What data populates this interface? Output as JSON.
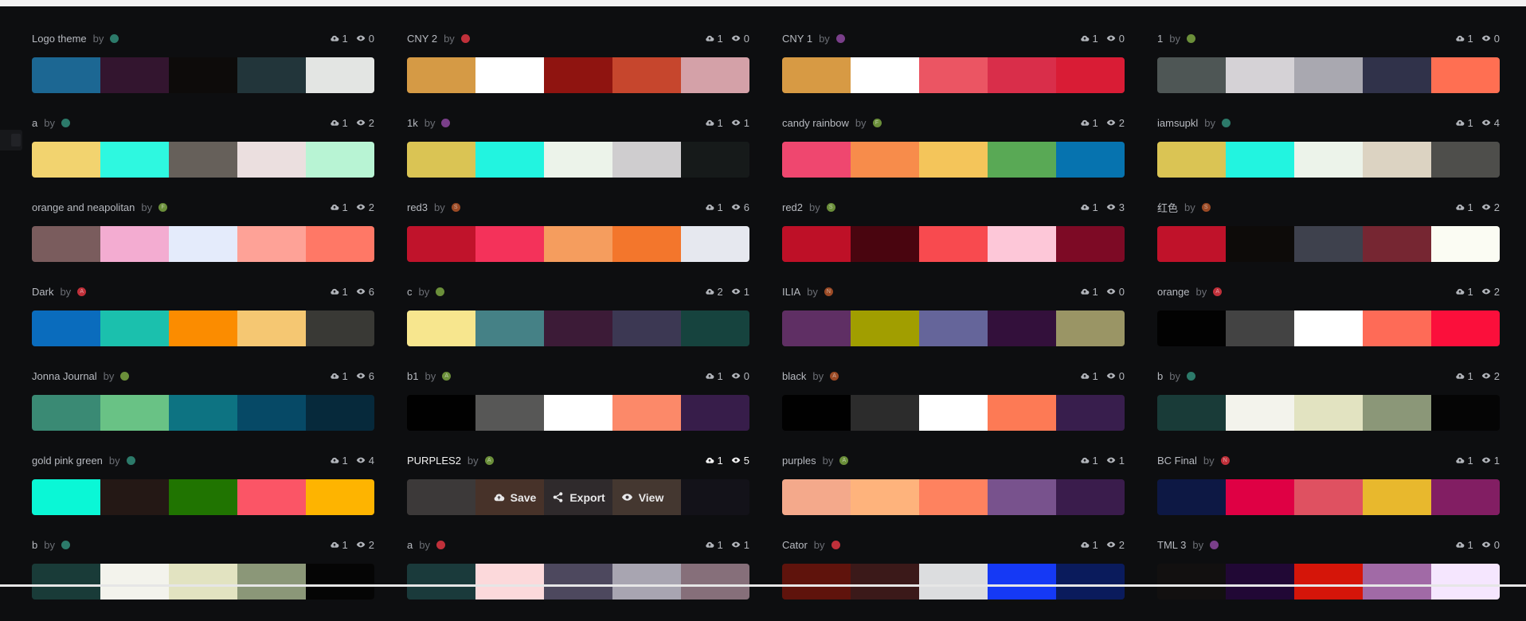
{
  "palettes": [
    {
      "name": "Logo theme",
      "by": "by",
      "avatar": "",
      "likes": "1",
      "views": "0",
      "colors": [
        "#1c6793",
        "#33152f",
        "#0d0b0a",
        "#22353a",
        "#e3e5e3"
      ]
    },
    {
      "name": "CNY 2",
      "by": "by",
      "avatar": "",
      "likes": "1",
      "views": "0",
      "colors": [
        "#d59a45",
        "#ffffff",
        "#8f1410",
        "#c6462d",
        "#d4a1a8"
      ]
    },
    {
      "name": "CNY 1",
      "by": "by",
      "avatar": "",
      "likes": "1",
      "views": "0",
      "colors": [
        "#d79a44",
        "#ffffff",
        "#eb5563",
        "#d92e4a",
        "#d91c35"
      ]
    },
    {
      "name": "1",
      "by": "by",
      "avatar": "",
      "likes": "1",
      "views": "0",
      "colors": [
        "#4e5655",
        "#d5d2d6",
        "#a9a8b0",
        "#30324a",
        "#ff6f52"
      ]
    },
    {
      "name": "a",
      "by": "by",
      "avatar": "",
      "likes": "1",
      "views": "2",
      "colors": [
        "#f2d36f",
        "#2ef8e0",
        "#66605a",
        "#ebdfdf",
        "#b8f4d4"
      ]
    },
    {
      "name": "1k",
      "by": "by",
      "avatar": "",
      "likes": "1",
      "views": "1",
      "colors": [
        "#dac454",
        "#22f4e0",
        "#ecf3ea",
        "#cfcdcf",
        "#161a1a"
      ]
    },
    {
      "name": "candy rainbow",
      "by": "by",
      "avatar": "F",
      "likes": "1",
      "views": "2",
      "colors": [
        "#ef476f",
        "#f78c4b",
        "#f4c55a",
        "#59a955",
        "#0673af"
      ]
    },
    {
      "name": "iamsupkl",
      "by": "by",
      "avatar": "",
      "likes": "1",
      "views": "4",
      "colors": [
        "#dac454",
        "#22f4e0",
        "#ecf3ea",
        "#dcd3c2",
        "#4e4e4b"
      ]
    },
    {
      "name": "orange and neapolitan",
      "by": "by",
      "avatar": "F",
      "likes": "1",
      "views": "2",
      "colors": [
        "#7a5c5d",
        "#f3acd1",
        "#e4ebfb",
        "#fea297",
        "#ff7866"
      ]
    },
    {
      "name": "red3",
      "by": "by",
      "avatar": "S",
      "likes": "1",
      "views": "6",
      "colors": [
        "#c0132b",
        "#f4325a",
        "#f59d5e",
        "#f3762c",
        "#e6e8ef"
      ]
    },
    {
      "name": "red2",
      "by": "by",
      "avatar": "S",
      "likes": "1",
      "views": "3",
      "colors": [
        "#be1027",
        "#49050f",
        "#f84a4f",
        "#fdc7d8",
        "#7d0a25"
      ]
    },
    {
      "name": "红色",
      "by": "by",
      "avatar": "S",
      "likes": "1",
      "views": "2",
      "colors": [
        "#c0122a",
        "#0d0b09",
        "#3e414d",
        "#762632",
        "#fbfcf3"
      ]
    },
    {
      "name": "Dark",
      "by": "by",
      "avatar": "A",
      "likes": "1",
      "views": "6",
      "colors": [
        "#0a6cbd",
        "#1bc0ad",
        "#fb8c00",
        "#f5c772",
        "#393935"
      ]
    },
    {
      "name": "c",
      "by": "by",
      "avatar": "",
      "likes": "2",
      "views": "1",
      "colors": [
        "#f7e68e",
        "#458186",
        "#3c1b37",
        "#3c3853",
        "#16433e"
      ]
    },
    {
      "name": "ILIA",
      "by": "by",
      "avatar": "N",
      "likes": "1",
      "views": "0",
      "colors": [
        "#5f2f64",
        "#a19e00",
        "#65659a",
        "#33103b",
        "#9a9565"
      ]
    },
    {
      "name": "orange",
      "by": "by",
      "avatar": "A",
      "likes": "1",
      "views": "2",
      "colors": [
        "#020202",
        "#434343",
        "#ffffff",
        "#fe6b57",
        "#fb0f3b"
      ]
    },
    {
      "name": "Jonna Journal",
      "by": "by",
      "avatar": "",
      "likes": "1",
      "views": "6",
      "colors": [
        "#3a8a74",
        "#69c285",
        "#0d7382",
        "#064966",
        "#06293b"
      ]
    },
    {
      "name": "b1",
      "by": "by",
      "avatar": "A",
      "likes": "1",
      "views": "0",
      "colors": [
        "#010101",
        "#575756",
        "#ffffff",
        "#fc8969",
        "#371d4a"
      ]
    },
    {
      "name": "black",
      "by": "by",
      "avatar": "A",
      "likes": "1",
      "views": "0",
      "colors": [
        "#010101",
        "#2c2c2c",
        "#ffffff",
        "#fd7a55",
        "#381e4d"
      ]
    },
    {
      "name": "b",
      "by": "by",
      "avatar": "",
      "likes": "1",
      "views": "2",
      "colors": [
        "#193b38",
        "#f3f3ec",
        "#e2e3c1",
        "#8b9778",
        "#050505"
      ]
    },
    {
      "name": "gold pink green",
      "by": "by",
      "avatar": "",
      "likes": "1",
      "views": "4",
      "colors": [
        "#0af7d6",
        "#241815",
        "#207401",
        "#fb5566",
        "#feb400"
      ]
    },
    {
      "name": "PURPLES2",
      "by": "by",
      "avatar": "A",
      "likes": "1",
      "views": "5",
      "colors": [
        "#4d4848",
        "#5b3f33",
        "#3b3437",
        "#57463c",
        "#16141e"
      ]
    },
    {
      "name": "purples",
      "by": "by",
      "avatar": "A",
      "likes": "1",
      "views": "1",
      "colors": [
        "#f4a98b",
        "#feb37c",
        "#fe825f",
        "#78528d",
        "#3a1c4c"
      ]
    },
    {
      "name": "BC Final",
      "by": "by",
      "avatar": "N",
      "likes": "1",
      "views": "1",
      "colors": [
        "#0d1844",
        "#df0044",
        "#df5161",
        "#e8b82d",
        "#821e63"
      ]
    },
    {
      "name": "b",
      "by": "by",
      "avatar": "",
      "likes": "1",
      "views": "2",
      "colors": [
        "#193b38",
        "#f3f3ec",
        "#e2e3c1",
        "#8b9778",
        "#050505"
      ]
    },
    {
      "name": "a",
      "by": "by",
      "avatar": "",
      "likes": "1",
      "views": "1",
      "colors": [
        "#1a3a3b",
        "#fcd9db",
        "#4d485e",
        "#a8a5b1",
        "#866f7a"
      ]
    },
    {
      "name": "Cator",
      "by": "by",
      "avatar": "",
      "likes": "1",
      "views": "2",
      "colors": [
        "#5f130c",
        "#3b1919",
        "#dcdddf",
        "#1539f5",
        "#0a1b5c"
      ]
    },
    {
      "name": "TML 3",
      "by": "by",
      "avatar": "",
      "likes": "1",
      "views": "0",
      "colors": [
        "#121010",
        "#210835",
        "#d51509",
        "#a16aa6",
        "#f5e6fe"
      ]
    }
  ],
  "avatar_colors": [
    "#2c7a6a",
    "#c0303a",
    "#7a3f8a",
    "#9b4a25",
    "#6b8f3a"
  ],
  "hover_actions": {
    "save": "Save",
    "export": "Export",
    "view": "View"
  },
  "hovered_index": 21
}
